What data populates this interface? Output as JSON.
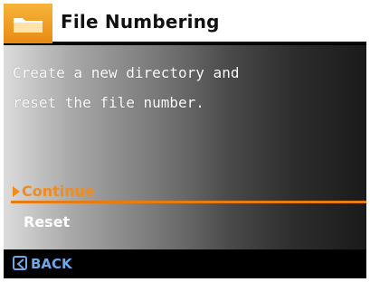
{
  "header": {
    "title": "File Numbering",
    "icon": "folder-icon"
  },
  "description": {
    "line1": "Create a new directory and",
    "line2": "reset the file number."
  },
  "menu": {
    "items": [
      {
        "label": "Continue",
        "selected": true
      },
      {
        "label": "Reset",
        "selected": false
      }
    ]
  },
  "footer": {
    "back_label": "BACK",
    "back_icon": "chevron-left-icon"
  },
  "colors": {
    "accent": "#f08c1c",
    "header_icon_bg": "#f0a02a",
    "footer_text": "#6fa7e8"
  }
}
